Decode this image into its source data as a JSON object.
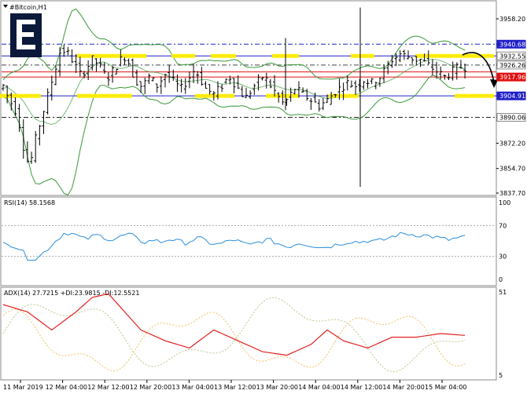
{
  "main": {
    "title": "#Bitcoin,H1",
    "ticks": [
      "3958.20",
      "3940.68",
      "3926.26",
      "3904.91",
      "3890.06",
      "3872.20",
      "3854.70",
      "3837.70"
    ],
    "ylim": [
      3832,
      3968
    ],
    "tags": [
      {
        "label": "3940.68",
        "price": 3940.68,
        "color": "#ffffff",
        "bg": "#2020c8"
      },
      {
        "label": "3932.55",
        "price": 3932.55,
        "color": "#000000",
        "bg": "#ffffff"
      },
      {
        "label": "3926.26",
        "price": 3926.26,
        "color": "#000000",
        "bg": "#ffffff"
      },
      {
        "label": "3917.96",
        "price": 3917.96,
        "color": "#ffffff",
        "bg": "#e01010"
      },
      {
        "label": "3904.91",
        "price": 3904.91,
        "color": "#ffffff",
        "bg": "#2020c8"
      },
      {
        "label": "3890.06",
        "price": 3890.06,
        "color": "#000000",
        "bg": "#ffffff"
      }
    ],
    "levels": [
      {
        "price": 3940.68,
        "color": "#2020c8",
        "style": "dashdot"
      },
      {
        "price": 3932.55,
        "color": "#2020c8",
        "style": "solid"
      },
      {
        "price": 3926.26,
        "color": "#444444",
        "style": "dashdot"
      },
      {
        "price": 3921.5,
        "color": "#e01010",
        "style": "solid"
      },
      {
        "price": 3917.96,
        "color": "#e01010",
        "style": "solid"
      },
      {
        "price": 3904.91,
        "color": "#2020c8",
        "style": "solid"
      },
      {
        "price": 3890.06,
        "color": "#222222",
        "style": "dashdot"
      }
    ]
  },
  "rsi": {
    "title": "RSI(14) 58.1568",
    "ticks": [
      "100",
      "70",
      "30",
      "0"
    ],
    "levels": [
      70,
      30
    ]
  },
  "adx": {
    "title": "ADX(14) 27.7215 +DI:23.9815 -DI:12.5521",
    "ticks": [
      "51",
      "5"
    ]
  },
  "xaxis": {
    "labels": [
      "11 Mar 2019",
      "12 Mar 04:00",
      "12 Mar 12:00",
      "12 Mar 20:00",
      "13 Mar 04:00",
      "13 Mar 12:00",
      "13 Mar 20:00",
      "14 Mar 04:00",
      "14 Mar 12:00",
      "14 Mar 20:00",
      "15 Mar 04:00"
    ]
  },
  "colors": {
    "candle": "#000000",
    "bollinger": "#3a9a3a",
    "rsi_line": "#2b8fdb",
    "adx_line": "#e02020",
    "plus_di": "#b8c88a",
    "minus_di": "#f0c060",
    "highlight": "#ffee00",
    "arrow": "#000000"
  },
  "icons": {
    "logo": "company-logo-icon",
    "menu": "chart-menu-icon"
  }
}
